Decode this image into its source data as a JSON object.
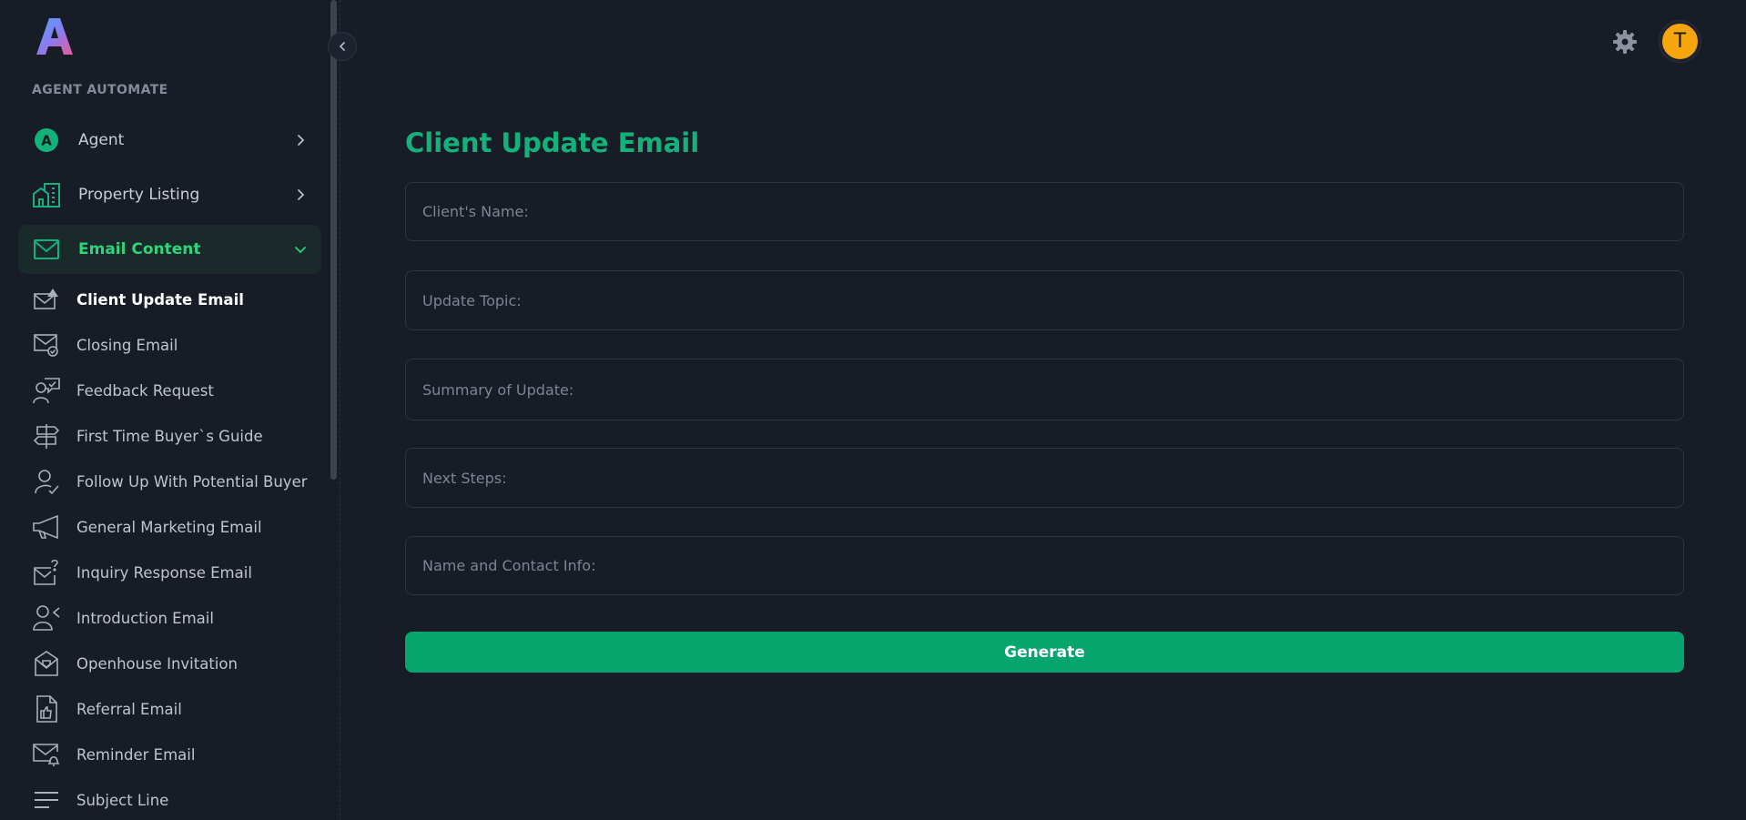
{
  "brand": {
    "section_label": "AGENT AUTOMATE"
  },
  "menu": [
    {
      "label": "Agent",
      "icon": "agent-badge-icon"
    },
    {
      "label": "Property Listing",
      "icon": "building-icon"
    },
    {
      "label": "Email Content",
      "icon": "mail-icon",
      "active": true
    }
  ],
  "submenu": [
    {
      "label": "Client Update Email",
      "icon": "mail-alert-icon",
      "current": true
    },
    {
      "label": "Closing Email",
      "icon": "mail-check-icon"
    },
    {
      "label": "Feedback Request",
      "icon": "user-feedback-icon"
    },
    {
      "label": "First Time Buyer`s Guide",
      "icon": "signpost-icon"
    },
    {
      "label": "Follow Up With Potential Buyer",
      "icon": "user-check-icon"
    },
    {
      "label": "General Marketing Email",
      "icon": "megaphone-icon"
    },
    {
      "label": "Inquiry Response Email",
      "icon": "mail-question-icon"
    },
    {
      "label": "Introduction Email",
      "icon": "user-wave-icon"
    },
    {
      "label": "Openhouse Invitation",
      "icon": "open-mail-icon"
    },
    {
      "label": "Referral Email",
      "icon": "thumbs-up-file-icon"
    },
    {
      "label": "Reminder Email",
      "icon": "mail-bell-icon"
    },
    {
      "label": "Subject Line",
      "icon": "lines-icon"
    }
  ],
  "header": {
    "avatar_initial": "T"
  },
  "main": {
    "title": "Client Update Email",
    "fields": [
      {
        "placeholder": "Client's Name:",
        "value": ""
      },
      {
        "placeholder": "Update Topic:",
        "value": ""
      },
      {
        "placeholder": "Summary of Update:",
        "value": ""
      },
      {
        "placeholder": "Next Steps:",
        "value": ""
      },
      {
        "placeholder": "Name and Contact Info:",
        "value": ""
      }
    ],
    "generate_label": "Generate"
  },
  "colors": {
    "background": "#171c26",
    "accent": "#05a56d",
    "title": "#12b27a",
    "active_text": "#2ed47c",
    "avatar": "#f5a60b"
  }
}
